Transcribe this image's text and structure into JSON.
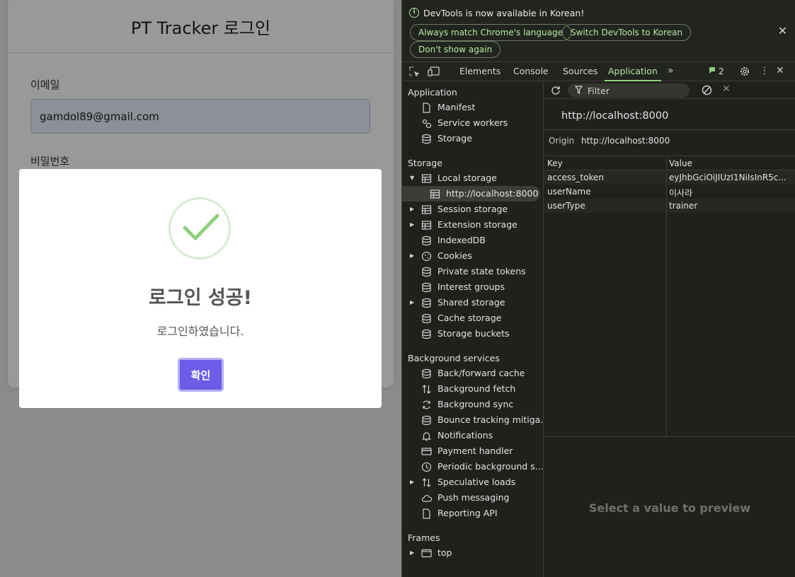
{
  "page": {
    "title": "PT Tracker 로그인",
    "email_label": "이메일",
    "email_value": "gamdol89@gmail.com",
    "password_label": "비밀번호"
  },
  "modal": {
    "title": "로그인 성공!",
    "text": "로그인하였습니다.",
    "confirm_label": "확인"
  },
  "devtools": {
    "infobar": {
      "message": "DevTools is now available in Korean!",
      "btn_match": "Always match Chrome's language",
      "btn_switch": "Switch DevTools to Korean",
      "btn_dont_show": "Don't show again"
    },
    "tabs": [
      "Elements",
      "Console",
      "Sources",
      "Application"
    ],
    "active_tab": "Application",
    "issues_count": "2",
    "sidebar": {
      "application_section": "Application",
      "application_items": [
        "Manifest",
        "Service workers",
        "Storage"
      ],
      "storage_section": "Storage",
      "local_storage": "Local storage",
      "local_storage_child": "http://localhost:8000",
      "storage_items": [
        "Session storage",
        "Extension storage",
        "IndexedDB",
        "Cookies",
        "Private state tokens",
        "Interest groups",
        "Shared storage",
        "Cache storage",
        "Storage buckets"
      ],
      "background_section": "Background services",
      "background_items": [
        "Back/forward cache",
        "Background fetch",
        "Background sync",
        "Bounce tracking mitiga...",
        "Notifications",
        "Payment handler",
        "Periodic background s...",
        "Speculative loads",
        "Push messaging",
        "Reporting API"
      ],
      "frames_section": "Frames",
      "frames_items": [
        "top"
      ]
    },
    "main": {
      "filter_placeholder": "Filter",
      "origin_title": "http://localhost:8000",
      "origin_key": "Origin",
      "origin_value": "http://localhost:8000",
      "table_headers": {
        "key": "Key",
        "value": "Value"
      },
      "rows": [
        {
          "key": "access_token",
          "value": "eyJhbGciOiJIUzI1NiIsInR5c..."
        },
        {
          "key": "userName",
          "value": "이사라"
        },
        {
          "key": "userType",
          "value": "trainer"
        }
      ],
      "preview_text": "Select a value to preview"
    }
  },
  "colors": {
    "accent_purple": "#6c5ce7",
    "check_green": "#8fd07f",
    "devtools_accent": "#b7e4a7"
  }
}
